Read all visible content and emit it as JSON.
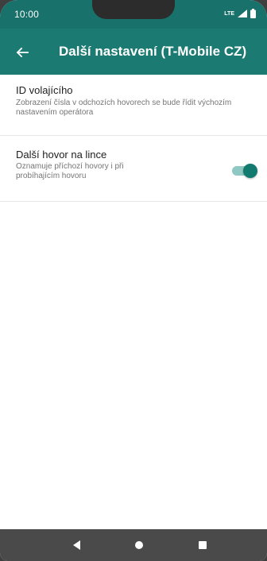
{
  "status_bar": {
    "time": "10:00",
    "network": "LTE",
    "icons": [
      "lte-icon",
      "signal-icon",
      "battery-icon"
    ]
  },
  "app_bar": {
    "title": "Další nastavení (T-Mobile CZ)",
    "back_icon": "arrow-left-icon"
  },
  "settings": [
    {
      "title": "ID volajícího",
      "subtitle": "Zobrazení čísla v odchozích hovorech se bude řídit výchozím nastavením operátora"
    },
    {
      "title": "Další hovor na lince",
      "subtitle": "Oznamuje příchozí hovory i při probíhajícím hovoru",
      "toggle_on": true
    }
  ],
  "nav_bar": {
    "icons": [
      "back-triangle-icon",
      "home-circle-icon",
      "recents-square-icon"
    ]
  },
  "colors": {
    "primary": "#1b7a72",
    "status_bar": "#18716a",
    "toggle_thumb": "#127a6e",
    "toggle_track": "#8fc8c2",
    "nav_bar": "#4a4a4a"
  }
}
